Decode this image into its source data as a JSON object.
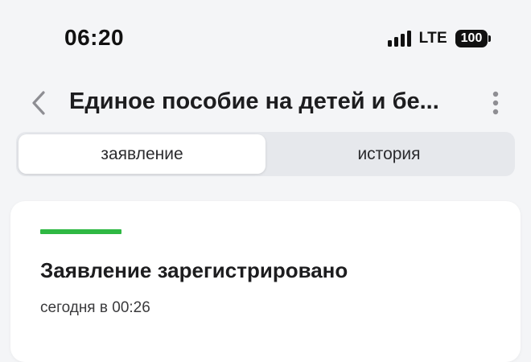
{
  "status_bar": {
    "time": "06:20",
    "network": "LTE",
    "battery": "100"
  },
  "header": {
    "title": "Единое пособие на детей и бе...",
    "back_icon": "chevron-left-icon",
    "more_icon": "more-vertical-icon"
  },
  "tabs": [
    {
      "label": "заявление",
      "active": true
    },
    {
      "label": "история",
      "active": false
    }
  ],
  "application_card": {
    "status": "Заявление зарегистрировано",
    "date": "сегодня в 00:26",
    "progress_color": "#2fb843"
  },
  "colors": {
    "background": "#f4f5f7",
    "accent_green": "#2fb843",
    "icon_gray": "#8e8e93"
  }
}
